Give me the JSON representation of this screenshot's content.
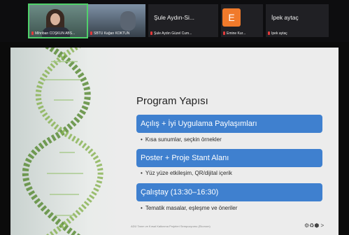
{
  "participants": [
    {
      "name": "Mihriban COŞKUN ABS...",
      "type": "video",
      "active": true
    },
    {
      "name": "SBTÜ Kağan KÖKTÜN",
      "type": "video"
    },
    {
      "name": "Şule Aydın-Si...",
      "caption": "Şule Aydın Güzel Cum...",
      "type": "name"
    },
    {
      "name": "E",
      "caption": "Emine Kur...",
      "type": "avatar",
      "color": "#f07a2b"
    },
    {
      "name": "İpek aytaç",
      "caption": "İpek aytaç",
      "type": "name"
    }
  ],
  "slide": {
    "title": "Program Yapısı",
    "sections": [
      {
        "heading": "Açılış + İyi Uygulama Paylaşımları",
        "bullet": "Kısa sunumlar, seçkin örnekler"
      },
      {
        "heading": "Poster + Proje Stant Alanı",
        "bullet": "Yüz yüze etkileşim, QR/dijital içerik"
      },
      {
        "heading": "Çalıştay (13:30–16:30)",
        "bullet": "Tematik masalar, eşleşme ve öneriler"
      }
    ],
    "footer": "ADÜ Tarım ve Kırsal Kalkınma Projeleri Sempozyumu (Ekonom)",
    "logos": "⚙♻⬢ >"
  },
  "colors": {
    "band": "#3f80cf",
    "active_speaker": "#4fd16a",
    "mic_muted": "#e23b3b"
  }
}
